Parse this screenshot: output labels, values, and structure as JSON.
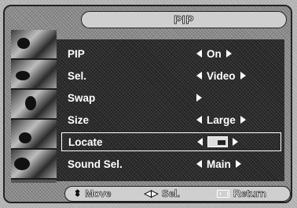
{
  "screen": {
    "title": "PIP"
  },
  "menu": {
    "rows": [
      {
        "label": "PIP",
        "value": "On",
        "has_left_arrow": true,
        "has_right_arrow": true,
        "selected": false
      },
      {
        "label": "Sel.",
        "value": "Video",
        "has_left_arrow": true,
        "has_right_arrow": true,
        "selected": false
      },
      {
        "label": "Swap",
        "value": "",
        "has_left_arrow": false,
        "has_right_arrow": true,
        "selected": false
      },
      {
        "label": "Size",
        "value": "Large",
        "has_left_arrow": true,
        "has_right_arrow": true,
        "selected": false
      },
      {
        "label": "Locate",
        "value": "",
        "has_left_arrow": true,
        "has_right_arrow": true,
        "selected": true,
        "value_icon": "pip-position-bottom-right-icon"
      },
      {
        "label": "Sound Sel.",
        "value": "Main",
        "has_left_arrow": true,
        "has_right_arrow": true,
        "selected": false
      }
    ]
  },
  "footer": {
    "move": {
      "icon": "up-down-icon",
      "label": "Move"
    },
    "select": {
      "icon": "left-right-icon",
      "label": "Sel."
    },
    "return": {
      "icon": "return-icon",
      "label": "Return"
    }
  }
}
